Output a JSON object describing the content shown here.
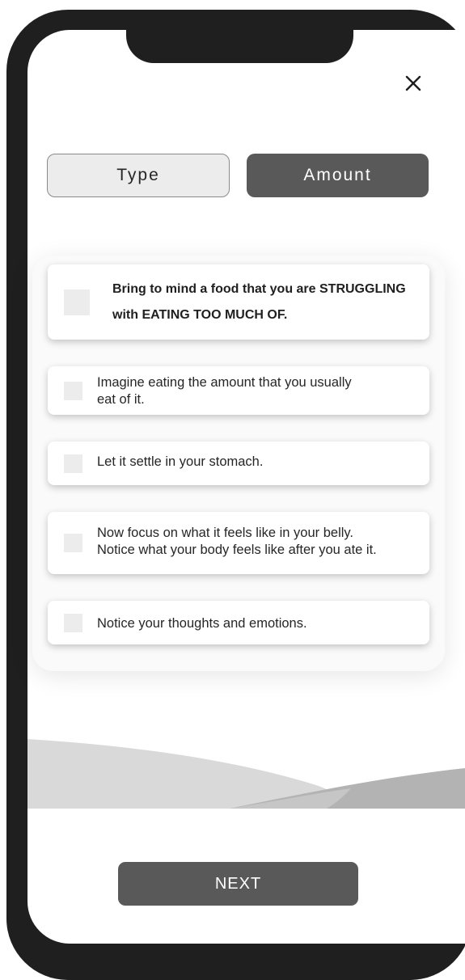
{
  "header": {
    "close_icon": "close-icon"
  },
  "segment": {
    "type_label": "Type",
    "amount_label": "Amount",
    "selected": "Amount"
  },
  "steps": [
    {
      "text": "Bring to mind a food that you are STRUGGLING\nwith EATING TOO MUCH OF.",
      "bold": true,
      "checked": false
    },
    {
      "text": "Imagine eating the amount that you usually\neat of it.",
      "bold": false,
      "checked": false
    },
    {
      "text": "Let it settle in your stomach.",
      "bold": false,
      "checked": false
    },
    {
      "text": "Now focus on what it feels like in your belly.\nNotice what your body feels like after you ate it.",
      "bold": false,
      "checked": false
    },
    {
      "text": "Notice your thoughts and emotions.",
      "bold": false,
      "checked": false
    }
  ],
  "footer": {
    "next_label": "NEXT"
  },
  "colors": {
    "frame": "#1f1f1f",
    "button_dark": "#595959",
    "button_light": "#ececec",
    "checkbox": "#ececec",
    "hill_light": "#d9d9d9",
    "hill_dark": "#b3b3b4"
  }
}
